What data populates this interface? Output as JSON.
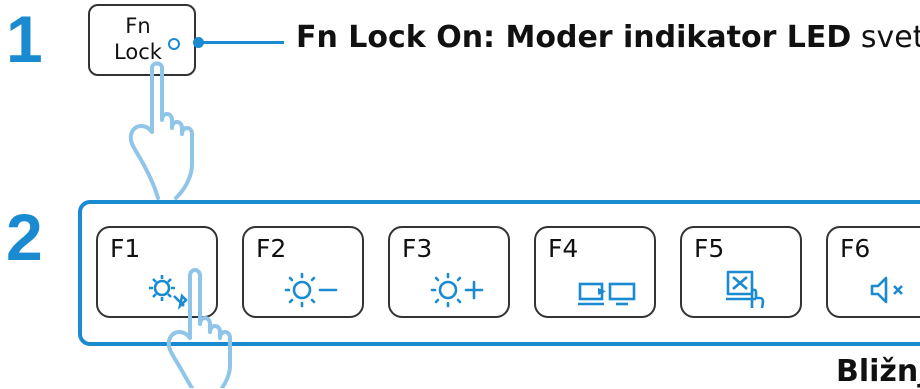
{
  "step1": {
    "number": "1",
    "key_line1": "Fn",
    "key_line2": "Lock",
    "description_bold": "Fn Lock On: Moder indikator LED",
    "description_rest": " sveti"
  },
  "step2": {
    "number": "2",
    "keys": [
      {
        "label": "F1",
        "icon": "settings-icon"
      },
      {
        "label": "F2",
        "icon": "brightness-down-icon"
      },
      {
        "label": "F3",
        "icon": "brightness-up-icon"
      },
      {
        "label": "F4",
        "icon": "display-switch-icon"
      },
      {
        "label": "F5",
        "icon": "touchpad-toggle-icon"
      },
      {
        "label": "F6",
        "icon": "mute-icon"
      }
    ]
  },
  "bottom_text": "Bližnj",
  "colors": {
    "accent": "#1a8bd0",
    "hand": "#8ec5e8",
    "key_border": "#333333"
  }
}
